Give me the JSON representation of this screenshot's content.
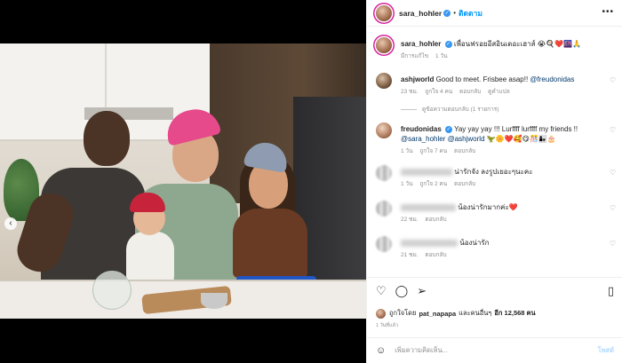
{
  "post": {
    "author": "sara_hohler",
    "follow_label": "ติดตาม",
    "more_icon": "more-horizontal-icon",
    "caption": {
      "username": "sara_hohler",
      "text": "เพื่อนฟรอยอีสอินเดอะเฮาส์ 😭🍳❤️🌆🙏",
      "meta_translate": "มีการแก้ไข",
      "meta_time": "1 วัน"
    }
  },
  "comments": [
    {
      "username": "ashjworld",
      "text": "Good to meet. Frisbee asap!! ",
      "mention": "@freudonidas",
      "time": "23 ชม.",
      "likes": "ถูกใจ 4 คน",
      "reply": "ตอบกลับ",
      "translate": "ดูคำแปล",
      "view_replies": "ดูข้อความตอบกลับ (1 รายการ)"
    },
    {
      "username": "freudonidas",
      "text": " Yay yay yay !!! Lurffff lurffff my friends !! ",
      "mention1": "@sara_hohler",
      "mention2": "@ashjworld",
      "emojis": "🦖🌼❤️🥰😋🎊👩‍👧🎂",
      "time": "1 วัน",
      "likes": "ถูกใจ 7 คน",
      "reply": "ตอบกลับ"
    },
    {
      "text": "น่ารักจัง ลงรูปเยอะๆนะคะ",
      "time": "1 วัน",
      "likes": "ถูกใจ 2 คน",
      "reply": "ตอบกลับ"
    },
    {
      "text": "น้องน่ารักมากค่ะ❤️",
      "time": "22 ชม.",
      "reply": "ตอบกลับ"
    },
    {
      "text": "น้องน่ารัก",
      "time": "21 ชม.",
      "reply": "ตอบกลับ"
    }
  ],
  "actions": {
    "like_icon": "heart-icon",
    "comment_icon": "comment-icon",
    "share_icon": "share-icon",
    "save_icon": "bookmark-icon"
  },
  "likes": {
    "prefix": "ถูกใจโดย",
    "user": "pat_napapa",
    "middle": "และคนอื่นๆ",
    "count_label": "อีก 12,568 คน"
  },
  "age": "1 วันที่แล้ว",
  "add_comment": {
    "placeholder": "เพิ่มความคิดเห็น...",
    "post_label": "โพสต์",
    "emoji_icon": "smiley-icon"
  },
  "colors": {
    "accent": "#0095f6",
    "muted": "#8e8e8e",
    "verified": "#3897f0"
  }
}
